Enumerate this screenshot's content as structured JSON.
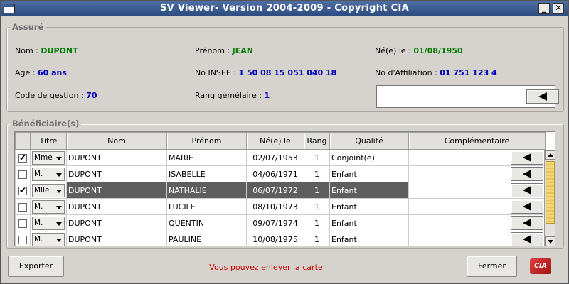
{
  "window": {
    "title": "SV Viewer- Version 2004-2009 - Copyright CIA",
    "minimize_glyph": "_",
    "close_glyph": "✕"
  },
  "assure": {
    "group_title": "Assuré",
    "nom": {
      "label": "Nom :",
      "value": "DUPONT"
    },
    "prenom": {
      "label": "Prénom :",
      "value": "JEAN"
    },
    "ne_le": {
      "label": "Né(e) le :",
      "value": "01/08/1950"
    },
    "age": {
      "label": "Age :",
      "value": "60 ans"
    },
    "insee": {
      "label": "No INSEE :",
      "value": "1 50 08 15 051 040 18"
    },
    "affiliation": {
      "label": "No d'Affiliation :",
      "value": "01 751 123 4"
    },
    "code_gestion": {
      "label": "Code de gestion :",
      "value": "70"
    },
    "rang": {
      "label": "Rang gémélaire :",
      "value": "1"
    },
    "search_value": ""
  },
  "beneficiaires": {
    "group_title": "Bénéficiaire(s)",
    "columns": [
      "",
      "Titre",
      "Nom",
      "Prénom",
      "Né(e) le",
      "Rang",
      "Qualité",
      "Complémentaire"
    ],
    "rows": [
      {
        "checked": true,
        "titre": "Mme",
        "nom": "DUPONT",
        "prenom": "MARIE",
        "ne": "02/07/1953",
        "rang": "1",
        "qualite": "Conjoint(e)",
        "selected": false
      },
      {
        "checked": false,
        "titre": "M.",
        "nom": "DUPONT",
        "prenom": "ISABELLE",
        "ne": "04/06/1971",
        "rang": "1",
        "qualite": "Enfant",
        "selected": false
      },
      {
        "checked": true,
        "titre": "Mlle",
        "nom": "DUPONT",
        "prenom": "NATHALIE",
        "ne": "06/07/1972",
        "rang": "1",
        "qualite": "Enfant",
        "selected": true
      },
      {
        "checked": false,
        "titre": "M.",
        "nom": "DUPONT",
        "prenom": "LUCILE",
        "ne": "08/10/1973",
        "rang": "1",
        "qualite": "Enfant",
        "selected": false
      },
      {
        "checked": false,
        "titre": "M.",
        "nom": "DUPONT",
        "prenom": "QUENTIN",
        "ne": "09/07/1974",
        "rang": "1",
        "qualite": "Enfant",
        "selected": false
      },
      {
        "checked": false,
        "titre": "M.",
        "nom": "DUPONT",
        "prenom": "PAULINE",
        "ne": "10/08/1975",
        "rang": "1",
        "qualite": "Enfant",
        "selected": false
      }
    ]
  },
  "footer": {
    "export_label": "Exporter",
    "status": "Vous pouvez enlever la carte",
    "close_label": "Fermer",
    "logo_text": "CIA"
  },
  "colors": {
    "title_bar": "#3d5e94",
    "value_green": "#007a00",
    "value_blue": "#0000b8",
    "status_red": "#d00000",
    "selected_row": "#5e5e5e",
    "scroll_thumb": "#f2d67a"
  },
  "icons": [
    "window-icon",
    "minimize-icon",
    "close-icon",
    "left-arrow-icon",
    "dropdown-arrow-icon",
    "checkbox-icon",
    "scroll-up-icon",
    "scroll-down-icon",
    "cia-logo"
  ]
}
